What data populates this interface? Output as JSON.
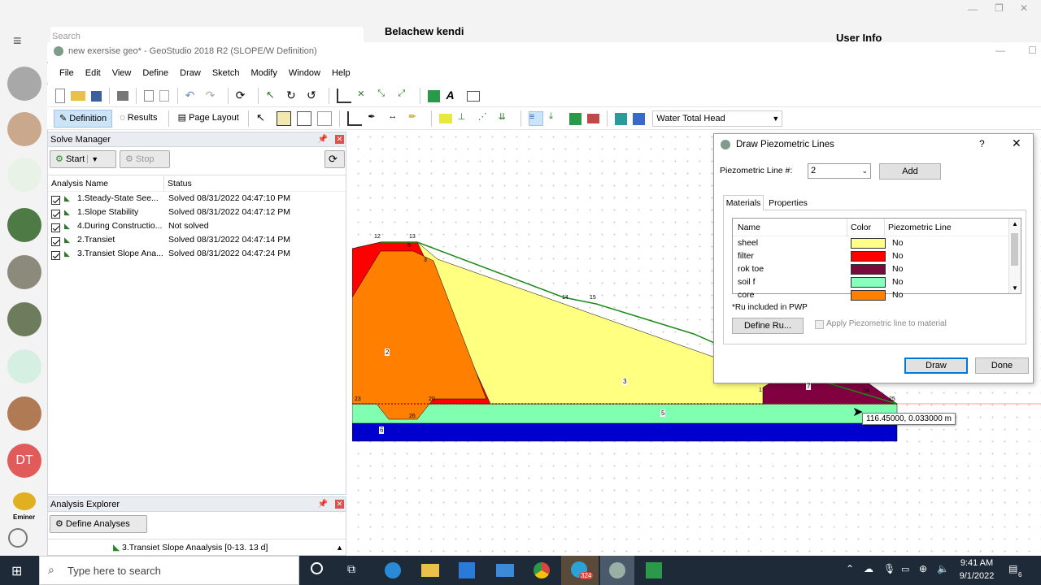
{
  "background_app": {
    "search_placeholder": "Search",
    "chat_name": "Belachew kendi",
    "panel_title": "User Info",
    "avatar_initials": "DT",
    "eminer_label": "Eminer"
  },
  "window": {
    "title": "new exersise geo* - GeoStudio 2018 R2 (SLOPE/W Definition)"
  },
  "menu": [
    "File",
    "Edit",
    "View",
    "Define",
    "Draw",
    "Sketch",
    "Modify",
    "Window",
    "Help"
  ],
  "toolbar2": {
    "definition": "Definition",
    "results": "Results",
    "page_layout": "Page Layout",
    "view_select": "Water Total Head"
  },
  "solve_manager": {
    "title": "Solve Manager",
    "start": "Start",
    "stop": "Stop",
    "columns": [
      "Analysis Name",
      "Status"
    ],
    "rows": [
      {
        "name": "1.Steady-State See...",
        "status": "Solved 08/31/2022 04:47:10 PM"
      },
      {
        "name": "1.Slope Stability",
        "status": "Solved 08/31/2022 04:47:12 PM"
      },
      {
        "name": "4.During Constructio...",
        "status": "Not solved"
      },
      {
        "name": "2.Transiet",
        "status": "Solved 08/31/2022 04:47:14 PM"
      },
      {
        "name": "3.Transiet Slope Ana...",
        "status": "Solved 08/31/2022 04:47:24 PM"
      }
    ]
  },
  "analysis_explorer": {
    "title": "Analysis Explorer",
    "define_btn": "Define Analyses",
    "item": "3.Transiet Slope Anaalysis [0-13. 13 d]"
  },
  "canvas": {
    "region_labels": [
      "2",
      "3",
      "5",
      "6",
      "7"
    ],
    "point_labels": [
      "12",
      "13",
      "5",
      "3",
      "14",
      "15",
      "23",
      "20",
      "1",
      "24",
      "25",
      "26"
    ],
    "cursor_readout": "116.45000, 0.033000 m"
  },
  "dialog": {
    "title": "Draw Piezometric Lines",
    "help": "?",
    "line_label": "Piezometric Line #:",
    "line_value": "2",
    "add": "Add",
    "tabs": [
      "Materials",
      "Properties"
    ],
    "columns": [
      "Name",
      "Color",
      "Piezometric Line"
    ],
    "materials": [
      {
        "name": "sheel",
        "color": "#ffff88",
        "pl": "No"
      },
      {
        "name": "filter",
        "color": "#ff0000",
        "pl": "No"
      },
      {
        "name": "rok toe",
        "color": "#7a0a3c",
        "pl": "No"
      },
      {
        "name": "soil f",
        "color": "#88ffbb",
        "pl": "No"
      },
      {
        "name": "core",
        "color": "#ff8000",
        "pl": "No"
      }
    ],
    "ru_note": "*Ru included in PWP",
    "define_ru": "Define Ru...",
    "apply_label": "Apply Piezometric line to material",
    "draw": "Draw",
    "done": "Done"
  },
  "taskbar": {
    "search": "Type here to search",
    "time": "9:41 AM",
    "date": "9/1/2022",
    "badge": "324",
    "notif": "6"
  }
}
